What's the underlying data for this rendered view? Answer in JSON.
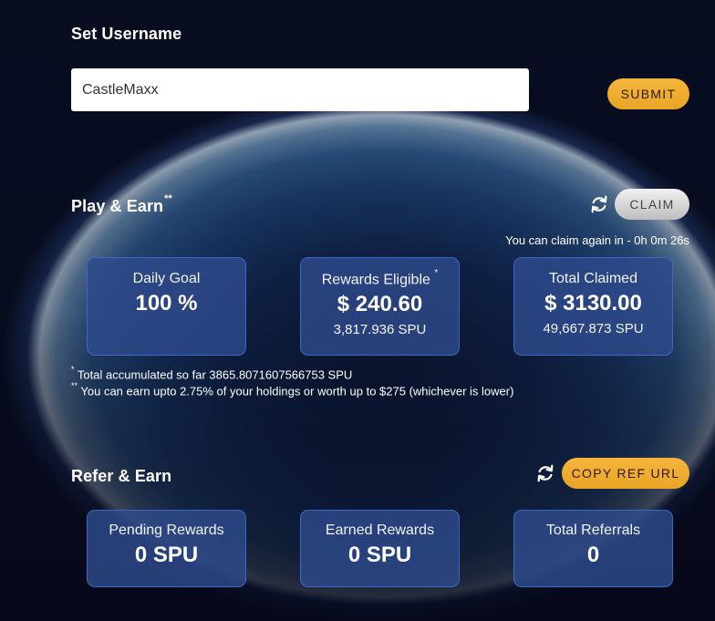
{
  "username": {
    "title": "Set Username",
    "input_value": "CastleMaxx",
    "submit_label": "SUBMIT"
  },
  "play_earn": {
    "title": "Play & Earn",
    "title_mark": "**",
    "claim_label": "CLAIM",
    "claim_timer": "You can claim again in - 0h 0m 26s",
    "cards": {
      "daily_goal": {
        "label": "Daily Goal",
        "value": "100 %"
      },
      "rewards_eligible": {
        "label": "Rewards Eligible",
        "mark": "*",
        "value": "$ 240.60",
        "sub": "3,817.936 SPU"
      },
      "total_claimed": {
        "label": "Total Claimed",
        "value": "$ 3130.00",
        "sub": "49,667.873 SPU"
      }
    },
    "notes": [
      {
        "mark": "*",
        "text": "Total accumulated so far 3865.8071607566753 SPU"
      },
      {
        "mark": "**",
        "text": "You can earn upto 2.75% of your holdings or worth up to $275 (whichever is lower)"
      }
    ]
  },
  "refer_earn": {
    "title": "Refer & Earn",
    "copy_label": "COPY REF URL",
    "cards": {
      "pending": {
        "label": "Pending Rewards",
        "value": "0 SPU"
      },
      "earned": {
        "label": "Earned Rewards",
        "value": "0 SPU"
      },
      "referrals": {
        "label": "Total Referrals",
        "value": "0"
      }
    }
  },
  "icons": {
    "refresh": "refresh-icon"
  },
  "colors": {
    "accent_gold": "#f0ae34",
    "card_bg": "#2e4a8c",
    "card_border": "#3f67c4"
  }
}
